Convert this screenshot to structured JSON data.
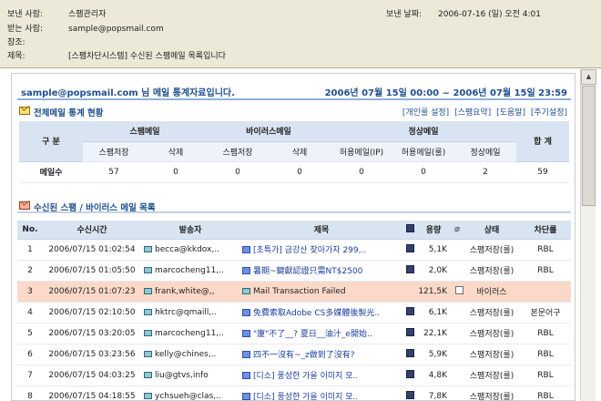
{
  "header": {
    "from_label": "보낸 사람:",
    "from_value": "스팸관리자",
    "date_label": "보낸 날짜:",
    "date_value": "2006-07-16 (일) 오전 4:01",
    "to_label": "받는 사람:",
    "to_value": "sample@popsmail.com",
    "cc_label": "참조:",
    "cc_value": "",
    "subject_label": "제목:",
    "subject_value": "[스팸차단시스템] 수신된 스팸메일 목록입니다"
  },
  "report": {
    "title": "sample@popsmail.com 님 메일 통계자료입니다.",
    "period": "2006년 07월 15일 00:00 ~ 2006년 07월 15일 23:59",
    "stats_section_title": "전체메일 통계 현황",
    "links": [
      "[개인룰 설정]",
      "[스팸요약]",
      "[도움말]",
      "[주기설정]"
    ],
    "list_section_title": "수신된 스팸 / 바이러스 메일 목록"
  },
  "stats": {
    "gubun": "구 분",
    "groups": [
      "스팸메일",
      "바이러스메일",
      "정상메일"
    ],
    "total_label": "합 계",
    "subheaders": [
      "스팸저장",
      "삭제",
      "스팸저장",
      "삭제",
      "허용메일(IP)",
      "허용메일(룰)",
      "정상메일"
    ],
    "row_label": "메일수",
    "values": [
      "57",
      "0",
      "0",
      "0",
      "0",
      "0",
      "2"
    ],
    "total": "59"
  },
  "list": {
    "headers": {
      "no": "No.",
      "time": "수신시간",
      "sender": "발송자",
      "subject": "제목",
      "size": "용량",
      "status": "상태",
      "rule": "차단룰"
    },
    "rows": [
      {
        "no": "1",
        "time": "2006/07/15 01:02:54",
        "sender": "becca@kkdox,..",
        "subject": "[초특가] 금강산 찾아가자 299,..",
        "size": "5,1K",
        "status": "스팸저장(룰)",
        "rule": "RBL"
      },
      {
        "no": "2",
        "time": "2006/07/15 01:05:50",
        "sender": "marcocheng11,..",
        "subject": "暑期~鍵獻認證只需NT$2500",
        "size": "2,0K",
        "status": "스팸저장(룰)",
        "rule": "RBL"
      },
      {
        "no": "3",
        "time": "2006/07/15 01:07:23",
        "sender": "frank,white@,,",
        "subject": "Mail Transaction Failed",
        "size": "121,5K",
        "status": "바이러스",
        "rule": ""
      },
      {
        "no": "4",
        "time": "2006/07/15 02:10:50",
        "sender": "hktrc@qmaill,..",
        "subject": "免費索取Adobe CS多媒體後製光..",
        "size": "6,1K",
        "status": "스팸저장(룰)",
        "rule": "본문어구"
      },
      {
        "no": "5",
        "time": "2006/07/15 03:20:05",
        "sender": "marcocheng11,..",
        "subject": "\"廈\"不了__? 夏日__油汁_e開始..",
        "size": "22,1K",
        "status": "스팸저장(룰)",
        "rule": "RBL"
      },
      {
        "no": "6",
        "time": "2006/07/15 03:23:56",
        "sender": "kelly@chines,..",
        "subject": "四不一沒有~_z做到了沒有?",
        "size": "5,9K",
        "status": "스팸저장(룰)",
        "rule": "RBL"
      },
      {
        "no": "7",
        "time": "2006/07/15 04:03:25",
        "sender": "liu@gtvs,info",
        "subject": "[디소] 풍성한 가을 이미지 모..",
        "size": "4,8K",
        "status": "스팸저장(룰)",
        "rule": "RBL"
      },
      {
        "no": "8",
        "time": "2006/07/15 04:18:55",
        "sender": "ychsueh@clas,..",
        "subject": "[디소] 풍성한 가을 이미지 모..",
        "size": "7,8K",
        "status": "스팸저장(룰)",
        "rule": "RBL"
      }
    ]
  }
}
